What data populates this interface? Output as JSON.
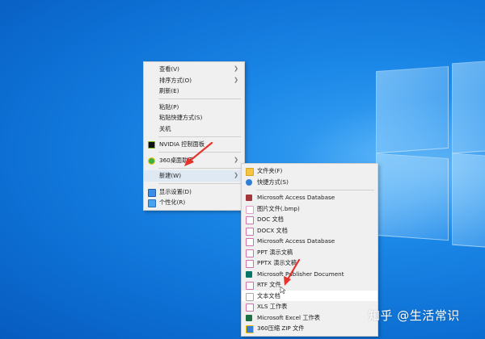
{
  "context_menu": {
    "items": [
      {
        "label": "查看(V)"
      },
      {
        "label": "排序方式(O)"
      },
      {
        "label": "刷新(E)"
      },
      {
        "label": "粘贴(P)"
      },
      {
        "label": "粘贴快捷方式(S)"
      },
      {
        "label": "关机"
      },
      {
        "label": "NVIDIA 控制面板"
      },
      {
        "label": "360桌面助手"
      },
      {
        "label": "新建(W)"
      },
      {
        "label": "显示设置(D)"
      },
      {
        "label": "个性化(R)"
      }
    ]
  },
  "new_submenu": {
    "items": [
      {
        "label": "文件夹(F)"
      },
      {
        "label": "快捷方式(S)"
      },
      {
        "label": "Microsoft Access Database"
      },
      {
        "label": "图片文件(.bmp)"
      },
      {
        "label": "DOC 文档"
      },
      {
        "label": "DOCX 文档"
      },
      {
        "label": "Microsoft Access Database"
      },
      {
        "label": "PPT 演示文稿"
      },
      {
        "label": "PPTX 演示文稿"
      },
      {
        "label": "Microsoft Publisher Document"
      },
      {
        "label": "RTF 文件"
      },
      {
        "label": "文本文档"
      },
      {
        "label": "XLS 工作表"
      },
      {
        "label": "Microsoft Excel 工作表"
      },
      {
        "label": "360压缩 ZIP 文件"
      }
    ]
  },
  "watermark": {
    "text": "知乎 @生活常识"
  },
  "colors": {
    "highlight": "#dfe9f4",
    "arrow": "#e8322c",
    "menu_bg": "#f0f0f0"
  }
}
